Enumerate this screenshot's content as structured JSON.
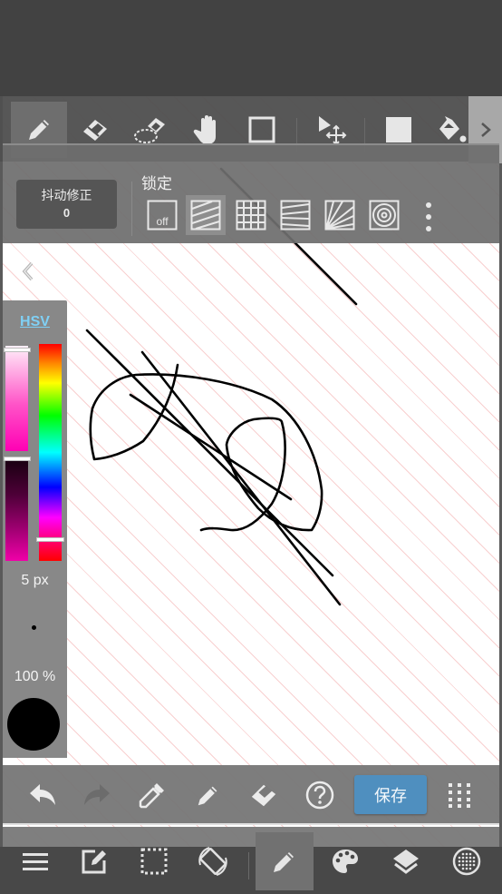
{
  "app": {
    "accent_color": "#4f8fbf",
    "canvas_guide_color": "#f09696"
  },
  "top_toolbar": {
    "tools": [
      {
        "name": "pen",
        "icon": "pen-icon",
        "active": true
      },
      {
        "name": "eraser",
        "icon": "eraser-icon",
        "active": false
      },
      {
        "name": "selection-eraser",
        "icon": "selection-eraser-icon",
        "active": false
      },
      {
        "name": "hand",
        "icon": "hand-icon",
        "active": false
      },
      {
        "name": "shape",
        "icon": "square-outline-icon",
        "active": false
      },
      {
        "name": "move",
        "icon": "move-select-icon",
        "active": false
      },
      {
        "name": "fill-rect",
        "icon": "filled-square-icon",
        "active": false
      },
      {
        "name": "bucket",
        "icon": "paint-bucket-icon",
        "active": false
      }
    ],
    "next_icon": "chevron-right-icon"
  },
  "lock_panel": {
    "stabilizer_label": "抖动修正",
    "stabilizer_value": "0",
    "lock_title": "锁定",
    "off_label": "off",
    "options": [
      {
        "name": "off",
        "icon": "lock-off-icon",
        "active": false
      },
      {
        "name": "parallel",
        "icon": "parallel-lines-icon",
        "active": true
      },
      {
        "name": "grid",
        "icon": "grid-icon",
        "active": false
      },
      {
        "name": "perspective",
        "icon": "perspective-lines-icon",
        "active": false
      },
      {
        "name": "radial",
        "icon": "radial-lines-icon",
        "active": false
      },
      {
        "name": "concentric",
        "icon": "concentric-circles-icon",
        "active": false
      }
    ],
    "more_icon": "more-vertical-icon"
  },
  "color_panel": {
    "mode_label": "HSV",
    "brush_size": "5 px",
    "opacity": "100 %",
    "current_color": "#000000",
    "saturation_level": 0.05,
    "value_level": 0.0,
    "hue_level": 0.91
  },
  "action_bar": {
    "undo_icon": "undo-icon",
    "redo_icon": "redo-icon",
    "eyedropper_icon": "eyedropper-icon",
    "pen_icon": "pen-icon",
    "eraser_icon": "eraser-icon",
    "help_icon": "help-circle-icon",
    "save_label": "保存",
    "grid_icon": "dots-grid-icon"
  },
  "bottom_nav": {
    "items": [
      {
        "name": "menu",
        "icon": "menu-icon",
        "active": false
      },
      {
        "name": "edit",
        "icon": "edit-icon",
        "active": false
      },
      {
        "name": "selection",
        "icon": "selection-icon",
        "active": false
      },
      {
        "name": "rotate",
        "icon": "rotate-icon",
        "active": false
      },
      {
        "name": "pen",
        "icon": "pen-icon",
        "active": true
      },
      {
        "name": "palette",
        "icon": "palette-icon",
        "active": false
      },
      {
        "name": "layers",
        "icon": "layers-icon",
        "active": false
      },
      {
        "name": "material",
        "icon": "material-icon",
        "active": false
      }
    ]
  }
}
